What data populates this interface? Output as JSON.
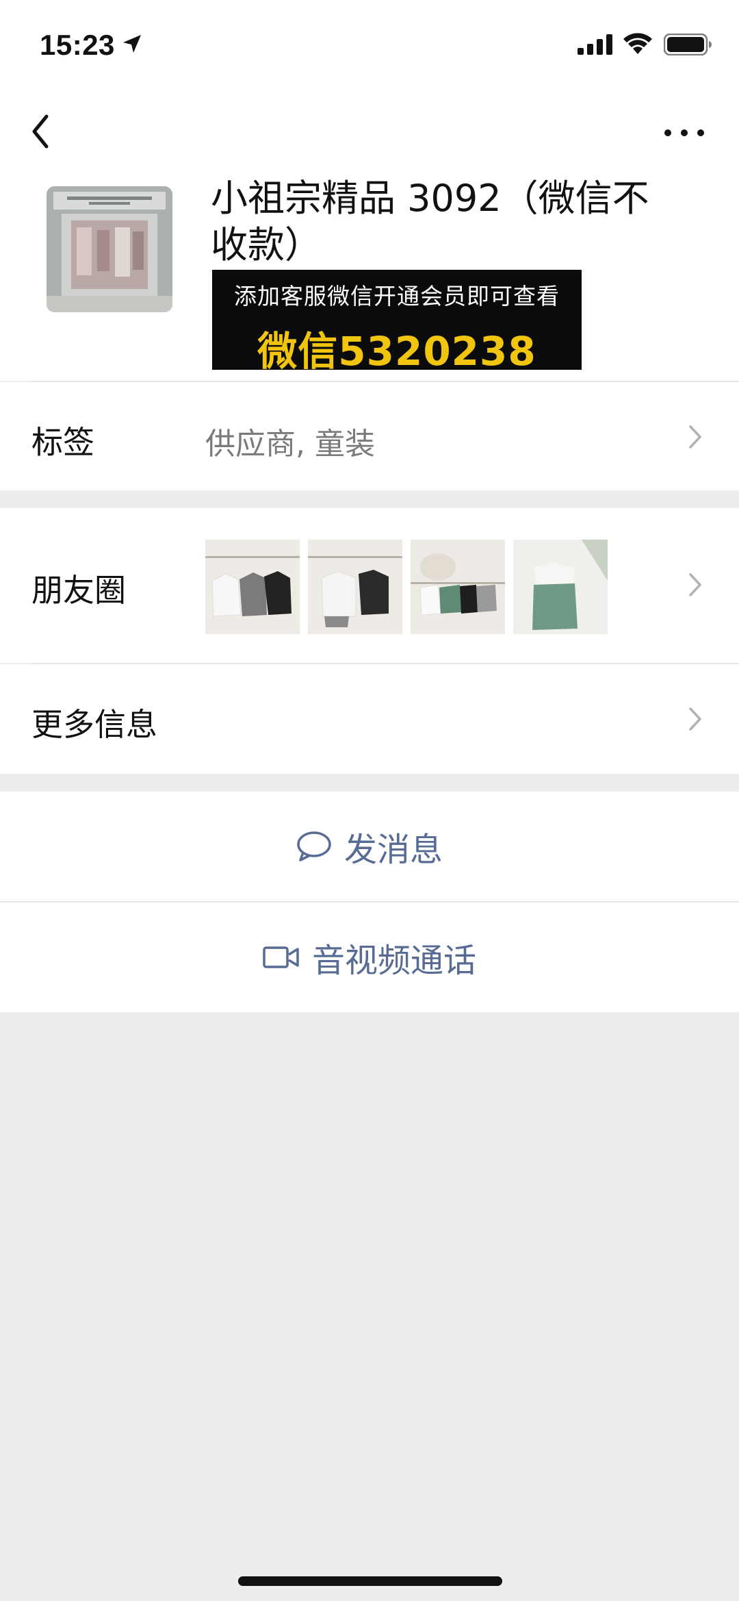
{
  "status_bar": {
    "time": "15:23"
  },
  "profile": {
    "name": "小祖宗精品 3092（微信不收款）",
    "ad_line1": "添加客服微信开通会员即可查看",
    "ad_line2": "微信5320238"
  },
  "rows": {
    "tags_label": "标签",
    "tags_value": "供应商, 童装",
    "moments_label": "朋友圈",
    "more_info_label": "更多信息"
  },
  "actions": {
    "message": "发消息",
    "call": "音视频通话"
  },
  "colors": {
    "link": "#576b95",
    "ad_highlight": "#f1c40f",
    "background": "#ededed"
  }
}
